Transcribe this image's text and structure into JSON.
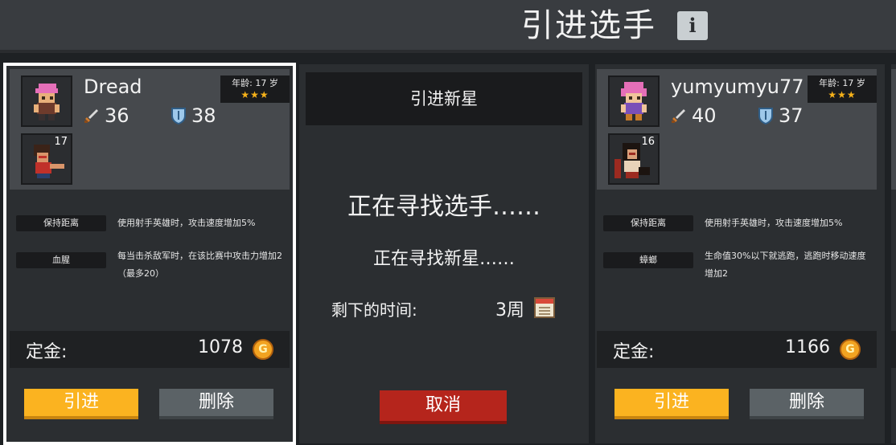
{
  "header": {
    "title": "引进选手",
    "info_icon": "i"
  },
  "cards": [
    {
      "name": "Dread",
      "attack": "36",
      "defense": "38",
      "age": "年龄: 17 岁",
      "stars": "★★★",
      "pet_level": "17",
      "traits": [
        {
          "tag": "保持距离",
          "desc": "使用射手英雄时，攻击速度增加5%"
        },
        {
          "tag": "血腥",
          "desc": "每当击杀敌军时，在该比赛中攻击力增加2（最多20）"
        }
      ],
      "fee_label": "定金:",
      "fee": "1078",
      "recruit_label": "引进",
      "delete_label": "删除"
    },
    {
      "name": "yumyumyu77",
      "attack": "40",
      "defense": "37",
      "age": "年龄: 17 岁",
      "stars": "★★★",
      "pet_level": "16",
      "traits": [
        {
          "tag": "保持距离",
          "desc": "使用射手英雄时，攻击速度增加5%"
        },
        {
          "tag": "蟑螂",
          "desc": "生命值30%以下就逃跑，逃跑时移动速度增加2"
        }
      ],
      "fee_label": "定金:",
      "fee": "1166",
      "recruit_label": "引进",
      "delete_label": "删除"
    }
  ],
  "search": {
    "heading": "引进新星",
    "searching": "正在寻找选手……",
    "searching_sub": "正在寻找新星……",
    "remaining_label": "剩下的时间:",
    "remaining_value": "3周",
    "cancel_label": "取消"
  },
  "colors": {
    "recruit": "#fbb320",
    "delete": "#5b6266",
    "cancel": "#b5251c",
    "star": "#f7b21a"
  }
}
